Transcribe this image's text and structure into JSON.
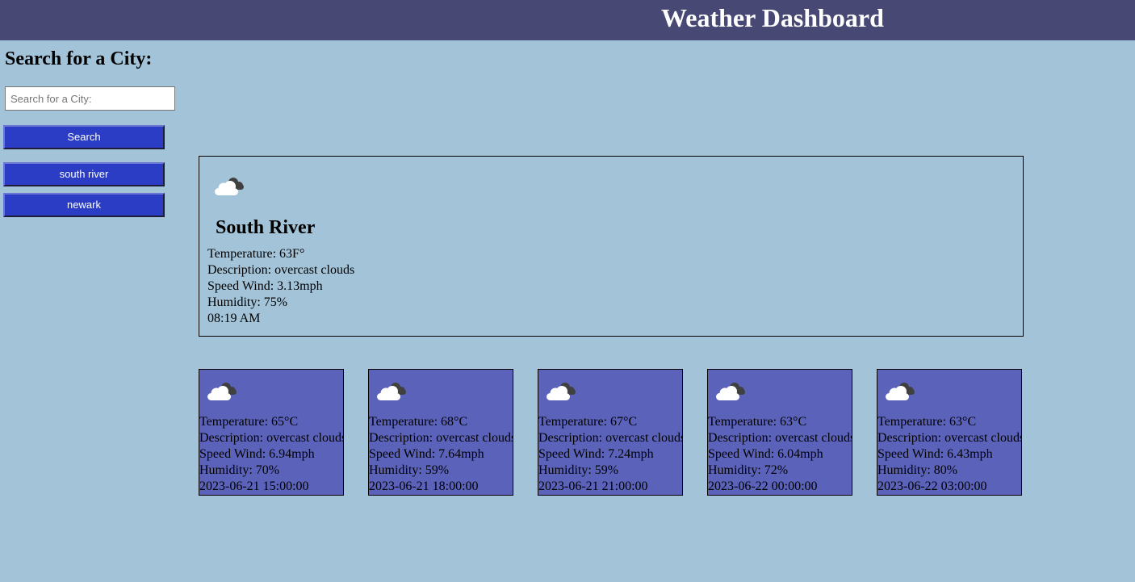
{
  "header": {
    "title": "Weather Dashboard"
  },
  "sidebar": {
    "title": "Search for a City:",
    "search_placeholder": "Search for a City:",
    "search_button": "Search",
    "history": [
      "south river",
      "newark"
    ]
  },
  "current": {
    "icon": "overcast-clouds-icon",
    "city": "South River",
    "temperature": "Temperature: 63F°",
    "description": "Description: overcast clouds",
    "wind": "Speed Wind: 3.13mph",
    "humidity": "Humidity: 75%",
    "time": "08:19 AM"
  },
  "forecast": [
    {
      "icon": "overcast-clouds-icon",
      "temperature": "Temperature: 65°C",
      "description": "Description: overcast clouds",
      "wind": "Speed Wind: 6.94mph",
      "humidity": "Humidity: 70%",
      "datetime": "2023-06-21 15:00:00"
    },
    {
      "icon": "overcast-clouds-icon",
      "temperature": "Temperature: 68°C",
      "description": "Description: overcast clouds",
      "wind": "Speed Wind: 7.64mph",
      "humidity": "Humidity: 59%",
      "datetime": "2023-06-21 18:00:00"
    },
    {
      "icon": "overcast-clouds-icon",
      "temperature": "Temperature: 67°C",
      "description": "Description: overcast clouds",
      "wind": "Speed Wind: 7.24mph",
      "humidity": "Humidity: 59%",
      "datetime": "2023-06-21 21:00:00"
    },
    {
      "icon": "overcast-clouds-icon",
      "temperature": "Temperature: 63°C",
      "description": "Description: overcast clouds",
      "wind": "Speed Wind: 6.04mph",
      "humidity": "Humidity: 72%",
      "datetime": "2023-06-22 00:00:00"
    },
    {
      "icon": "overcast-clouds-icon",
      "temperature": "Temperature: 63°C",
      "description": "Description: overcast clouds",
      "wind": "Speed Wind: 6.43mph",
      "humidity": "Humidity: 80%",
      "datetime": "2023-06-22 03:00:00"
    }
  ],
  "colors": {
    "background": "#a2c3d8",
    "header": "#474873",
    "button": "#2a3dc4",
    "forecast_card": "#5b62ba"
  }
}
